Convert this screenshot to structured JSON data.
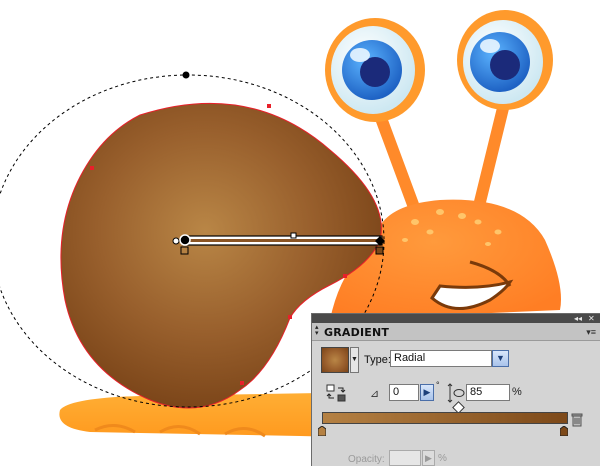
{
  "panel": {
    "title": "GRADIENT",
    "tab_arrows": "◆",
    "collapse_icon": "double-left-arrow-icon",
    "close_icon": "close-icon",
    "menu_icon": "panel-menu-icon"
  },
  "gradient": {
    "type_label": "Type:",
    "type_value": "Radial",
    "angle_value": "0",
    "angle_unit": "°",
    "aspect_value": "85",
    "aspect_unit": "%",
    "opacity_label": "Opacity:",
    "opacity_unit": "%",
    "start_color": "#b58143",
    "end_color": "#7d4919"
  },
  "artwork": {
    "subject": "snail",
    "shell_colors": [
      "#b98646",
      "#7a4418"
    ],
    "body_color": "#ff8a2a",
    "eye_color": "#3a8fe0"
  }
}
